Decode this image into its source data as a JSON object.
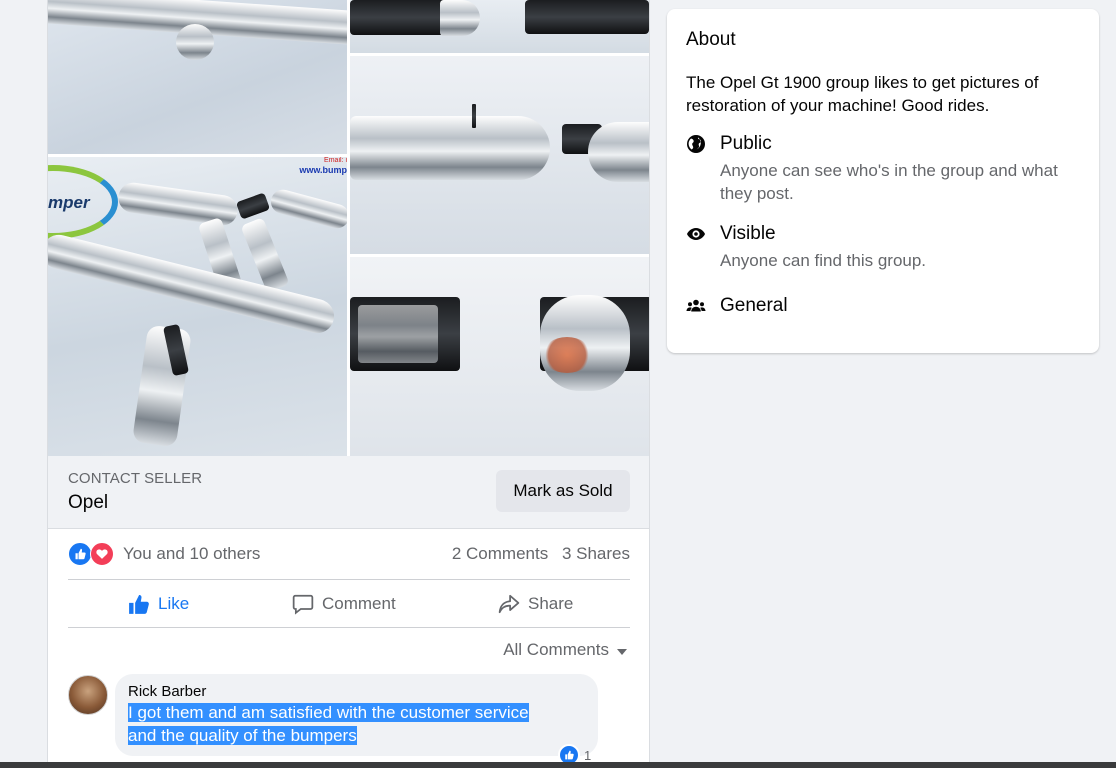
{
  "photos": {
    "email_label": "Email: i",
    "web_label": "www.bump",
    "logo_text": "mper"
  },
  "seller": {
    "contact_label": "CONTACT SELLER",
    "name": "Opel",
    "mark_sold_label": "Mark as Sold"
  },
  "reactions": {
    "summary": "You and 10 others",
    "comments_count": "2 Comments",
    "shares_count": "3 Shares"
  },
  "actions": {
    "like_label": "Like",
    "comment_label": "Comment",
    "share_label": "Share"
  },
  "comments": {
    "filter_label": "All Comments",
    "items": [
      {
        "author": "Rick Barber",
        "text_line1": "I got them and am satisfied with the customer service",
        "text_line2": "and the quality of the bumpers",
        "reaction_count": "1"
      }
    ]
  },
  "about": {
    "title": "About",
    "description": "The Opel Gt 1900 group likes to get pictures of restoration of your machine! Good rides.",
    "items": [
      {
        "icon": "globe-icon",
        "title": "Public",
        "desc": "Anyone can see who's in the group and what they post."
      },
      {
        "icon": "eye-icon",
        "title": "Visible",
        "desc": "Anyone can find this group."
      },
      {
        "icon": "people-icon",
        "title": "General",
        "desc": ""
      }
    ]
  },
  "colors": {
    "accent_blue": "#1877f2",
    "love_red": "#f33e58",
    "page_bg": "#f0f2f5",
    "selection": "#3390ff"
  }
}
